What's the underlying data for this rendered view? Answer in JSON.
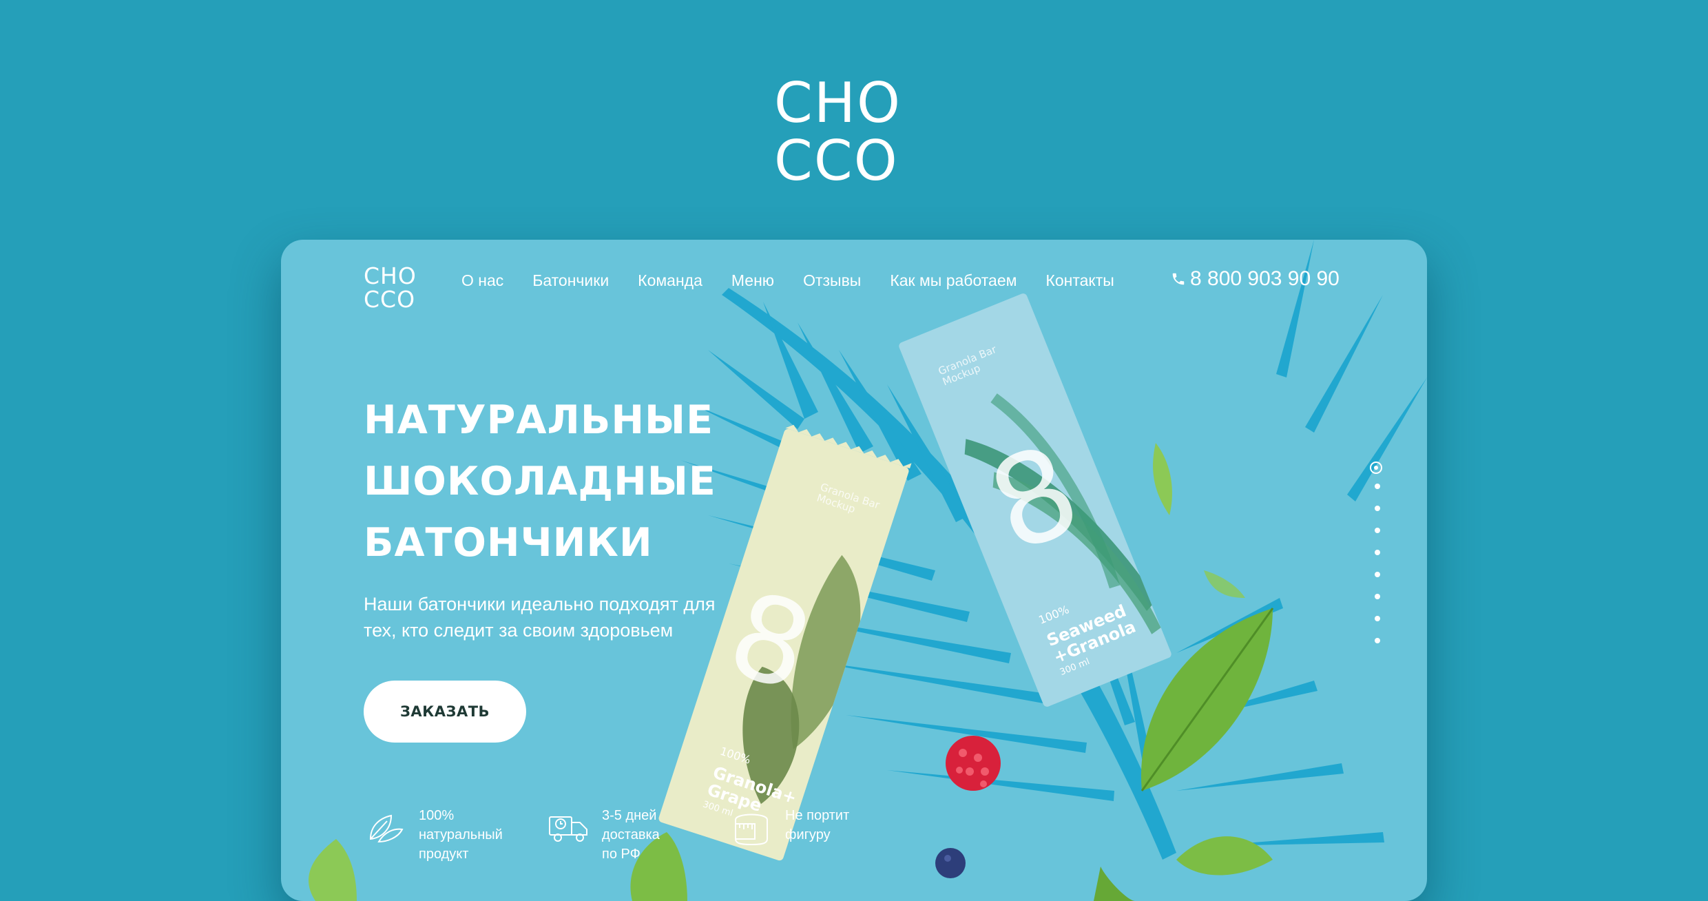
{
  "brand": {
    "logo_line1": "CHO",
    "logo_line2": "CCO"
  },
  "header": {
    "logo_line1": "CHO",
    "logo_line2": "CCO",
    "nav": [
      "О нас",
      "Батончики",
      "Команда",
      "Меню",
      "Отзывы",
      "Как мы работаем",
      "Контакты"
    ],
    "phone": "8 800 903 90 90",
    "phone_icon": "phone-icon"
  },
  "hero": {
    "title_lines": [
      "НАТУРАЛЬНЫЕ",
      "ШОКОЛАДНЫЕ",
      "БАТОНЧИКИ"
    ],
    "description": "Наши батончики идеально подходят для тех, кто следит за своим здоровьем",
    "cta_label": "ЗАКАЗАТЬ"
  },
  "features": [
    {
      "icon": "leaves-icon",
      "text": "100%\nнатуральный\nпродукт"
    },
    {
      "icon": "truck-icon",
      "text": "3-5 дней\nдоставка\nпо РФ"
    },
    {
      "icon": "scale-icon",
      "text": "Не портит\nфигуру"
    }
  ],
  "bars": [
    {
      "number": "8",
      "small_label": "Granola Bar\nMockup",
      "percent": "100%",
      "name": "Granola+\nGrape",
      "volume": "300 ml"
    },
    {
      "number": "8",
      "small_label": "Granola Bar\nMockup",
      "percent": "100%",
      "name": "Seaweed\n+Granola",
      "volume": "300 ml"
    }
  ],
  "slider": {
    "total": 9,
    "active": 0
  },
  "colors": {
    "page_bg": "#259fb9",
    "card_bg": "#68c4da",
    "leaf_blue": "#1ea6cf",
    "bar1": "#e9ecc8",
    "bar2": "#a3d7e6",
    "button_text": "#1f3a35"
  }
}
